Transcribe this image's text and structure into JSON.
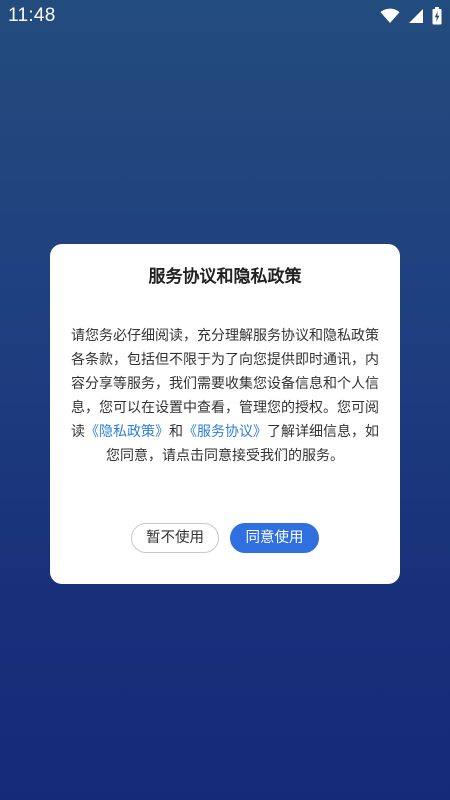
{
  "status_bar": {
    "time": "11:48",
    "icons": [
      "wifi-icon",
      "cellular-signal-icon",
      "battery-charging-icon"
    ]
  },
  "dialog": {
    "title": "服务协议和隐私政策",
    "body_part1": "请您务必仔细阅读，充分理解服务协议和隐私政策各条款，包括但不限于为了向您提供即时通讯，内容分享等服务，我们需要收集您设备信息和个人信息，您可以在设置中查看，管理您的授权。您可阅读",
    "privacy_link": "《隐私政策》",
    "body_and": "和",
    "agreement_link": "《服务协议》",
    "body_part2": "了解详细信息，如您同意，请点击同意接受我们的服务。",
    "decline_label": "暂不使用",
    "agree_label": "同意使用"
  },
  "colors": {
    "link": "#2e7fd9",
    "primary_button": "#2f6fe0",
    "background_top": "#234c7e",
    "background_bottom": "#152b78"
  }
}
